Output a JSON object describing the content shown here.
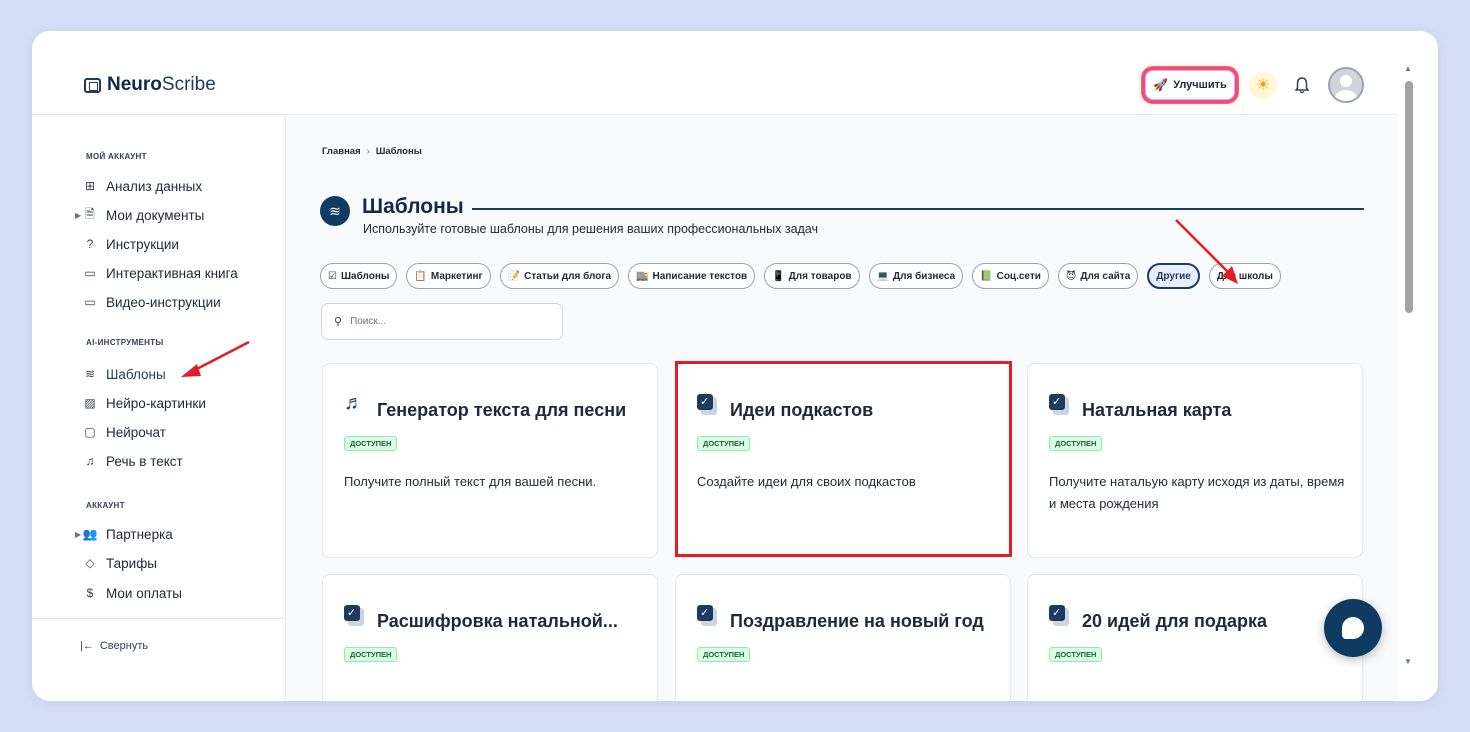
{
  "header": {
    "logo_bold": "Neuro",
    "logo_rest": "Scribe",
    "upgrade_label": "Улучшить"
  },
  "sidebar": {
    "section_account": "МОЙ АККАУНТ",
    "account_items": [
      {
        "label": "Анализ данных",
        "icon": "grid-icon"
      },
      {
        "label": "Мои документы",
        "icon": "document-icon"
      },
      {
        "label": "Инструкции",
        "icon": "help-icon"
      },
      {
        "label": "Интерактивная книга",
        "icon": "book-icon"
      },
      {
        "label": "Видео-инструкции",
        "icon": "video-icon"
      }
    ],
    "section_ai": "AI-ИНСТРУМЕНТЫ",
    "ai_items": [
      {
        "label": "Шаблоны",
        "icon": "layers-icon"
      },
      {
        "label": "Нейро-картинки",
        "icon": "image-icon"
      },
      {
        "label": "Нейрочат",
        "icon": "chat-icon"
      },
      {
        "label": "Речь в текст",
        "icon": "headphones-icon"
      }
    ],
    "section_acc2": "АККАУНТ",
    "acc2_items": [
      {
        "label": "Партнерка",
        "icon": "users-icon"
      },
      {
        "label": "Тарифы",
        "icon": "tag-icon"
      },
      {
        "label": "Мои оплаты",
        "icon": "dollar-icon"
      }
    ],
    "collapse_label": "Свернуть"
  },
  "main": {
    "breadcrumb": [
      "Главная",
      "Шаблоны"
    ],
    "title": "Шаблоны",
    "subtitle": "Используйте готовые шаблоны для решения ваших профессиональных задач",
    "search_placeholder": "Поиск...",
    "chips": [
      {
        "label": "Шаблоны",
        "emoji": "☑"
      },
      {
        "label": "Маркетинг",
        "emoji": "📋"
      },
      {
        "label": "Статьи для блога",
        "emoji": "📝"
      },
      {
        "label": "Написание текстов",
        "emoji": "🏬"
      },
      {
        "label": "Для товаров",
        "emoji": "📱"
      },
      {
        "label": "Для бизнеса",
        "emoji": "💻"
      },
      {
        "label": "Соц.сети",
        "emoji": "📗"
      },
      {
        "label": "Для сайта",
        "emoji": "😈"
      },
      {
        "label": "Другие",
        "emoji": ""
      },
      {
        "label": "Для школы",
        "emoji": ""
      }
    ],
    "selected_chip": "Другие",
    "cards": [
      {
        "title": "Генератор текста для песни",
        "badge": "ДОСТУПЕН",
        "desc": "Получите полный текст для вашей песни.",
        "icon": "music-note-icon"
      },
      {
        "title": "Идеи подкастов",
        "badge": "ДОСТУПЕН",
        "desc": "Создайте идеи для своих подкастов",
        "icon": "checkbox-icon"
      },
      {
        "title": "Натальная карта",
        "badge": "ДОСТУПЕН",
        "desc": "Получите натальую карту исходя из даты, время и места рождения",
        "icon": "checkbox-icon"
      },
      {
        "title": "Расшифровка натальной...",
        "badge": "ДОСТУПЕН",
        "desc": "",
        "icon": "checkbox-icon"
      },
      {
        "title": "Поздравление на новый год",
        "badge": "ДОСТУПЕН",
        "desc": "",
        "icon": "checkbox-icon"
      },
      {
        "title": "20 идей для подарка",
        "badge": "ДОСТУПЕН",
        "desc": "",
        "icon": "checkbox-icon"
      }
    ]
  },
  "colors": {
    "brand": "#0f3a62",
    "highlight": "#e11d2a",
    "badge_bg": "#dcfce7"
  }
}
